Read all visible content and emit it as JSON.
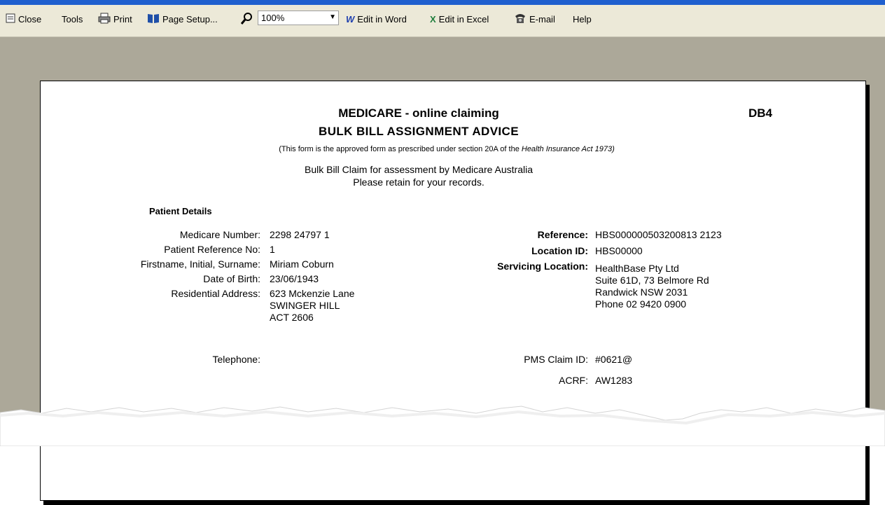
{
  "toolbar": {
    "close": "Close",
    "tools": "Tools",
    "print": "Print",
    "page_setup": "Page Setup...",
    "zoom_value": "100%",
    "edit_word": "Edit in Word",
    "edit_excel": "Edit in Excel",
    "email": "E-mail",
    "help": "Help"
  },
  "document": {
    "title": "MEDICARE - online claiming",
    "subtitle": "BULK BILL ASSIGNMENT ADVICE",
    "form_code": "DB4",
    "approved_prefix": "(This form is the approved form as prescribed under section 20A of the ",
    "approved_act": "Health Insurance Act 1973)",
    "claim_line1": "Bulk Bill Claim for assessment by Medicare Australia",
    "claim_line2": "Please retain for your records.",
    "patient_details_heading": "Patient Details",
    "left_fields": [
      {
        "label": "Medicare Number:",
        "value": "2298 24797 1"
      },
      {
        "label": "Patient Reference No:",
        "value": "1"
      },
      {
        "label": "Firstname, Initial, Surname:",
        "value": "Miriam Coburn"
      },
      {
        "label": "Date of Birth:",
        "value": "23/06/1943"
      },
      {
        "label": "Residential Address:",
        "value": "623 Mckenzie Lane"
      }
    ],
    "address_line2": "SWINGER HILL",
    "address_line3": "ACT   2606",
    "telephone_label": "Telephone:",
    "right_fields": [
      {
        "label": "Reference:",
        "value": "HBS000000503200813 2123"
      },
      {
        "label": "Location ID:",
        "value": "HBS00000"
      },
      {
        "label": "Servicing Location:",
        "value": "HealthBase Pty Ltd"
      }
    ],
    "servicing_line2": "Suite 61D, 73 Belmore Rd",
    "servicing_line3": "Randwick NSW 2031",
    "servicing_line4": "Phone 02 9420 0900",
    "pms_claim_label": "PMS Claim ID:",
    "pms_claim_value": "#0621@",
    "acrf_label": "ACRF:",
    "acrf_value": "AW1283"
  }
}
